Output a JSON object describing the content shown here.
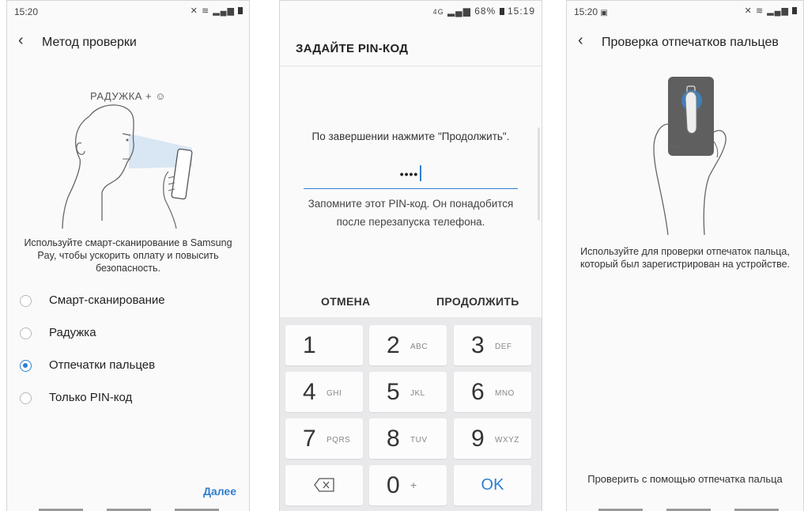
{
  "panel1": {
    "status": {
      "time": "15:20"
    },
    "title": "Метод проверки",
    "illustration_label": "РАДУЖКА + ",
    "description": "Используйте смарт-сканирование в Samsung Pay, чтобы ускорить оплату и повысить безопасность.",
    "options": [
      {
        "label": "Смарт-сканирование",
        "selected": false
      },
      {
        "label": "Радужка",
        "selected": false
      },
      {
        "label": "Отпечатки пальцев",
        "selected": true
      },
      {
        "label": "Только PIN-код",
        "selected": false
      }
    ],
    "next_label": "Далее"
  },
  "panel2": {
    "status": {
      "battery": "68%",
      "time": "15:19",
      "network": "4G"
    },
    "title": "ЗАДАЙТЕ PIN-КОД",
    "instruction": "По завершении нажмите \"Продолжить\".",
    "pin_masked": "••••",
    "note": "Запомните этот PIN-код. Он понадобится после перезапуска телефона.",
    "cancel_label": "ОТМЕНА",
    "continue_label": "ПРОДОЛЖИТЬ",
    "keys": [
      {
        "num": "1",
        "letters": ""
      },
      {
        "num": "2",
        "letters": "ABC"
      },
      {
        "num": "3",
        "letters": "DEF"
      },
      {
        "num": "4",
        "letters": "GHI"
      },
      {
        "num": "5",
        "letters": "JKL"
      },
      {
        "num": "6",
        "letters": "MNO"
      },
      {
        "num": "7",
        "letters": "PQRS"
      },
      {
        "num": "8",
        "letters": "TUV"
      },
      {
        "num": "9",
        "letters": "WXYZ"
      },
      {
        "num": "0",
        "letters": "+"
      }
    ],
    "ok_label": "OK"
  },
  "panel3": {
    "status": {
      "time": "15:20"
    },
    "title": "Проверка отпечатков пальцев",
    "description": "Используйте для проверки отпечаток пальца, который был зарегистрирован на устройстве.",
    "footer": "Проверить с помощью отпечатка пальца"
  },
  "colors": {
    "accent": "#2f7fd0",
    "background": "#fafafa",
    "keypad": "#e9e9eb"
  },
  "icons": [
    "back-arrow-icon",
    "wifi-icon",
    "signal-icon",
    "battery-icon",
    "backspace-icon",
    "image-icon",
    "mute-icon"
  ]
}
